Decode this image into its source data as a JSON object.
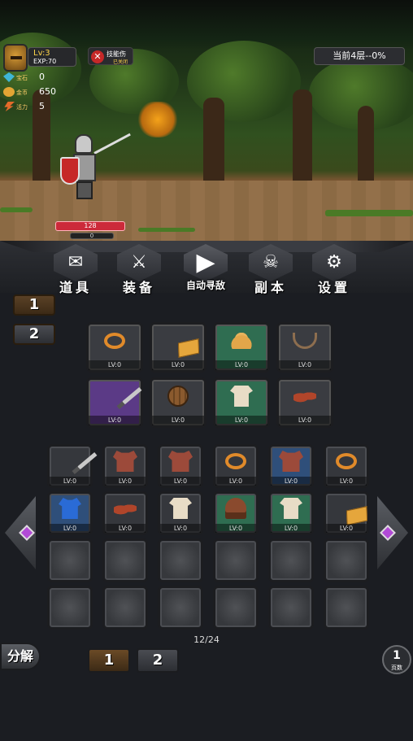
{
  "hud": {
    "level": "Lv:3",
    "exp": "EXP:70",
    "stats": [
      {
        "label": "宝石",
        "value": "0",
        "icon": "gem-icon",
        "color": "#3fb6d6"
      },
      {
        "label": "金币",
        "value": "650",
        "icon": "coin-icon",
        "color": "#e3a534"
      },
      {
        "label": "活力",
        "value": "5",
        "icon": "energy-icon",
        "color": "#e36a2a"
      }
    ],
    "skill": {
      "title": "技能伤",
      "subtitle": "已关闭"
    },
    "floor": "当前4层--0%"
  },
  "player": {
    "hp": "128",
    "mp": "0"
  },
  "menu": [
    {
      "label": "道具",
      "glyph": "✉",
      "icon": "scroll-icon"
    },
    {
      "label": "装备",
      "glyph": "⚔",
      "icon": "crossed-swords-icon"
    },
    {
      "label": "自动寻敌",
      "glyph": "▶",
      "icon": "play-icon"
    },
    {
      "label": "副本",
      "glyph": "☠",
      "icon": "dragon-icon"
    },
    {
      "label": "设置",
      "glyph": "⚙",
      "icon": "gear-icon"
    }
  ],
  "side_tabs": [
    "1",
    "2"
  ],
  "equipped": [
    {
      "item": "ring",
      "lv": "LV:0",
      "rarity": "normal"
    },
    {
      "item": "map",
      "lv": "LV:0",
      "rarity": "normal"
    },
    {
      "item": "hat",
      "lv": "LV:0",
      "rarity": "green"
    },
    {
      "item": "necklace",
      "lv": "LV:0",
      "rarity": "normal"
    },
    {
      "item": "sword",
      "lv": "LV:0",
      "rarity": "purple"
    },
    {
      "item": "barrel-shield",
      "lv": "LV:0",
      "rarity": "normal"
    },
    {
      "item": "shirt",
      "lv": "LV:0",
      "rarity": "green"
    },
    {
      "item": "shoes",
      "lv": "LV:0",
      "rarity": "normal"
    }
  ],
  "inventory": [
    {
      "item": "sword",
      "lv": "LV:0",
      "rarity": "normal"
    },
    {
      "item": "armor",
      "lv": "LV:0",
      "rarity": "normal"
    },
    {
      "item": "armor",
      "lv": "LV:0",
      "rarity": "normal"
    },
    {
      "item": "ring",
      "lv": "LV:0",
      "rarity": "normal"
    },
    {
      "item": "armor",
      "lv": "LV:0",
      "rarity": "blue"
    },
    {
      "item": "ring",
      "lv": "LV:0",
      "rarity": "normal"
    },
    {
      "item": "vest",
      "lv": "LV:0",
      "rarity": "blue"
    },
    {
      "item": "shoes",
      "lv": "LV:0",
      "rarity": "normal"
    },
    {
      "item": "shirt",
      "lv": "LV:0",
      "rarity": "normal"
    },
    {
      "item": "hood",
      "lv": "LV:0",
      "rarity": "green"
    },
    {
      "item": "shirt",
      "lv": "LV:0",
      "rarity": "green"
    },
    {
      "item": "map",
      "lv": "LV:0",
      "rarity": "normal"
    }
  ],
  "inventory_empty_slots": 12,
  "page_count": "12/24",
  "decompose_label": "分解",
  "page_buttons": [
    "1",
    "2"
  ],
  "page_indicator": {
    "number": "1",
    "label": "页数"
  }
}
